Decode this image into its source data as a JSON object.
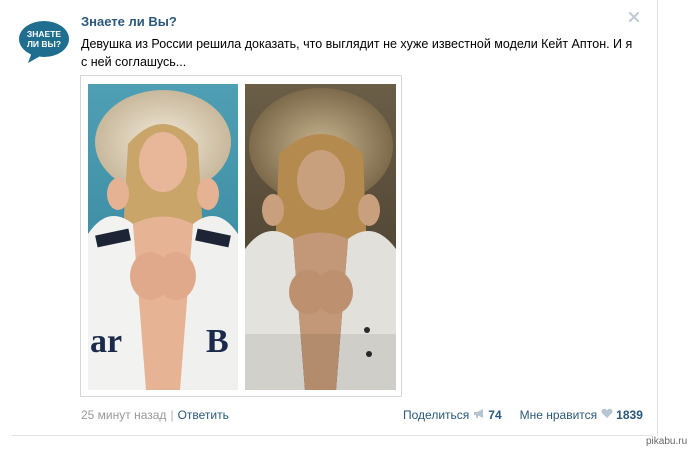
{
  "post": {
    "author": "Знаете ли Вы?",
    "avatar_text_line1": "ЗНАЕТЕ",
    "avatar_text_line2": "ЛИ ВЫ?",
    "text": "Девушка из России решила доказать, что выглядит не хуже известной модели Кейт Аптон. И я с ней соглашусь...",
    "images": [
      {
        "icon": "photo-model-magazine-cover",
        "cover_text": "ar",
        "cover_text_right": "B"
      },
      {
        "icon": "photo-girl-selfie"
      }
    ],
    "time": "25 минут назад",
    "separator": "|",
    "reply_label": "Ответить",
    "share_label": "Поделиться",
    "share_count": "74",
    "like_label": "Мне нравится",
    "like_count": "1839"
  },
  "watermark": "pikabu.ru",
  "colors": {
    "link": "#2b587a",
    "muted": "#999999",
    "avatar_bg": "#1f6e8f",
    "icon_gray": "#b7c5d3"
  }
}
